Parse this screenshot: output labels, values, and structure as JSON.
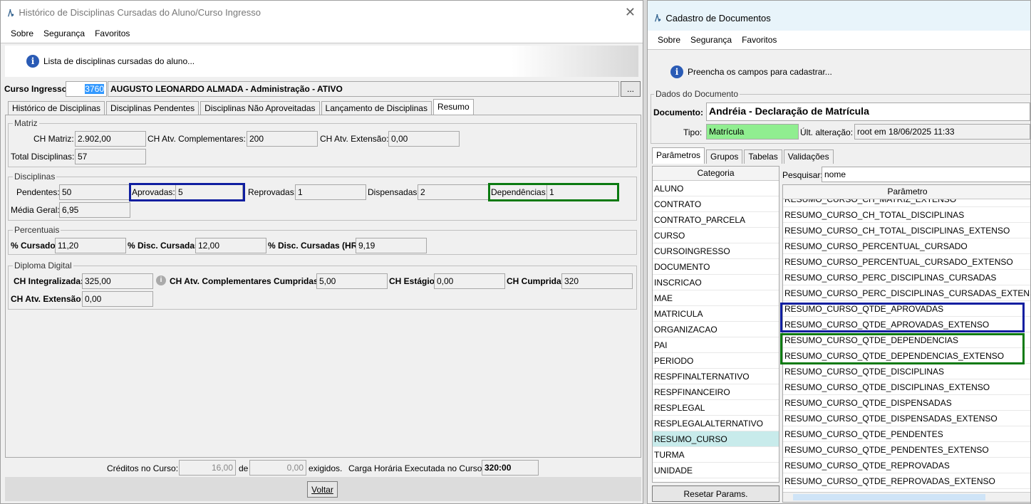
{
  "left_window": {
    "title": "Histórico de Disciplinas Cursadas do Aluno/Curso Ingresso",
    "close_glyph": "✕",
    "menu": [
      "Sobre",
      "Segurança",
      "Favoritos"
    ],
    "hint": "Lista de disciplinas cursadas do aluno...",
    "curso_ingresso": {
      "label": "Curso Ingresso:",
      "code": "3760",
      "description": "AUGUSTO LEONARDO ALMADA - Administração - ATIVO",
      "browse_label": "..."
    },
    "tabs": [
      "Histórico de Disciplinas",
      "Disciplinas Pendentes",
      "Disciplinas Não Aproveitadas",
      "Lançamento de Disciplinas",
      "Resumo"
    ],
    "active_tab": "Resumo",
    "matriz": {
      "title": "Matriz",
      "ch_matriz_label": "CH Matriz:",
      "ch_matriz": "2.902,00",
      "ch_atv_comp_label": "CH Atv. Complementares:",
      "ch_atv_comp": "200",
      "ch_atv_ext_label": "CH Atv. Extensão:",
      "ch_atv_ext": "0,00",
      "total_label": "Total Disciplinas:",
      "total": "57"
    },
    "disciplinas": {
      "title": "Disciplinas",
      "pendentes_label": "Pendentes:",
      "pendentes": "50",
      "aprovadas_label": "Aprovadas:",
      "aprovadas": "5",
      "reprovadas_label": "Reprovadas:",
      "reprovadas": "1",
      "dispensadas_label": "Dispensadas:",
      "dispensadas": "2",
      "dependencias_label": "Dependências:",
      "dependencias": "1",
      "media_label": "Média Geral:",
      "media": "6,95"
    },
    "percentuais": {
      "title": "Percentuais",
      "cursado_label": "% Cursado:",
      "cursado": "11,20",
      "disc_cursadas_label": "% Disc. Cursadas:",
      "disc_cursadas": "12,00",
      "disc_cursadas_hr_label": "% Disc. Cursadas (HR):",
      "disc_cursadas_hr": "9,19"
    },
    "diploma": {
      "title": "Diploma Digital",
      "ch_integralizada_label": "CH Integralizada:",
      "ch_integralizada": "325,00",
      "ch_atv_comp_cumpridas_label": "CH Atv. Complementares Cumpridas:",
      "ch_atv_comp_cumpridas": "5,00",
      "ch_estagio_label": "CH Estágio:",
      "ch_estagio": "0,00",
      "ch_cumprida_label": "CH Cumprida:",
      "ch_cumprida": "320",
      "ch_atv_extensao_label": "CH Atv. Extensão:",
      "ch_atv_extensao": "0,00"
    },
    "footer": {
      "creditos_label": "Créditos no Curso:",
      "creditos": "16,00",
      "de_label": "de",
      "exigidos": "0,00",
      "exigidos_label": "exigidos.",
      "carga_label": "Carga Horária Executada no Curso:",
      "carga": "320:00",
      "voltar_label": "Voltar"
    }
  },
  "right_window": {
    "title": "Cadastro de Documentos",
    "menu": [
      "Sobre",
      "Segurança",
      "Favoritos"
    ],
    "hint": "Preencha os campos para cadastrar...",
    "dados": {
      "title": "Dados do Documento",
      "documento_label": "Documento:",
      "documento": "Andréia - Declaração de Matrícula",
      "tipo_label": "Tipo:",
      "tipo": "Matrícula",
      "ult_alt_label": "Últ. alteração:",
      "ult_alt": "root em 18/06/2025 11:33"
    },
    "tabs": [
      "Parâmetros",
      "Grupos",
      "Tabelas",
      "Validações"
    ],
    "categoria_header": "Categoria",
    "categorias": [
      "ALUNO",
      "CONTRATO",
      "CONTRATO_PARCELA",
      "CURSO",
      "CURSOINGRESSO",
      "DOCUMENTO",
      "INSCRICAO",
      "MAE",
      "MATRICULA",
      "ORGANIZACAO",
      "PAI",
      "PERIODO",
      "RESPFINALTERNATIVO",
      "RESPFINANCEIRO",
      "RESPLEGAL",
      "RESPLEGALALTERNATIVO",
      "RESUMO_CURSO",
      "TURMA",
      "UNIDADE"
    ],
    "selected_categoria": "RESUMO_CURSO",
    "pesquisar_label": "Pesquisar:",
    "pesquisar": "nome",
    "parametro_header": "Parâmetro",
    "parametros": [
      "RESUMO_CURSO_CH_MATRIZ_EXTENSO",
      "RESUMO_CURSO_CH_TOTAL_DISCIPLINAS",
      "RESUMO_CURSO_CH_TOTAL_DISCIPLINAS_EXTENSO",
      "RESUMO_CURSO_PERCENTUAL_CURSADO",
      "RESUMO_CURSO_PERCENTUAL_CURSADO_EXTENSO",
      "RESUMO_CURSO_PERC_DISCIPLINAS_CURSADAS",
      "RESUMO_CURSO_PERC_DISCIPLINAS_CURSADAS_EXTENSO",
      "RESUMO_CURSO_QTDE_APROVADAS",
      "RESUMO_CURSO_QTDE_APROVADAS_EXTENSO",
      "RESUMO_CURSO_QTDE_DEPENDENCIAS",
      "RESUMO_CURSO_QTDE_DEPENDENCIAS_EXTENSO",
      "RESUMO_CURSO_QTDE_DISCIPLINAS",
      "RESUMO_CURSO_QTDE_DISCIPLINAS_EXTENSO",
      "RESUMO_CURSO_QTDE_DISPENSADAS",
      "RESUMO_CURSO_QTDE_DISPENSADAS_EXTENSO",
      "RESUMO_CURSO_QTDE_PENDENTES",
      "RESUMO_CURSO_QTDE_PENDENTES_EXTENSO",
      "RESUMO_CURSO_QTDE_REPROVADAS",
      "RESUMO_CURSO_QTDE_REPROVADAS_EXTENSO"
    ],
    "resetar_label": "Resetar Params."
  },
  "colors": {
    "highlight_blue": "#0f1ea0",
    "highlight_green": "#0a7a10",
    "tipo_bg": "#90ee90",
    "selected_row": "#c8ebeb"
  }
}
